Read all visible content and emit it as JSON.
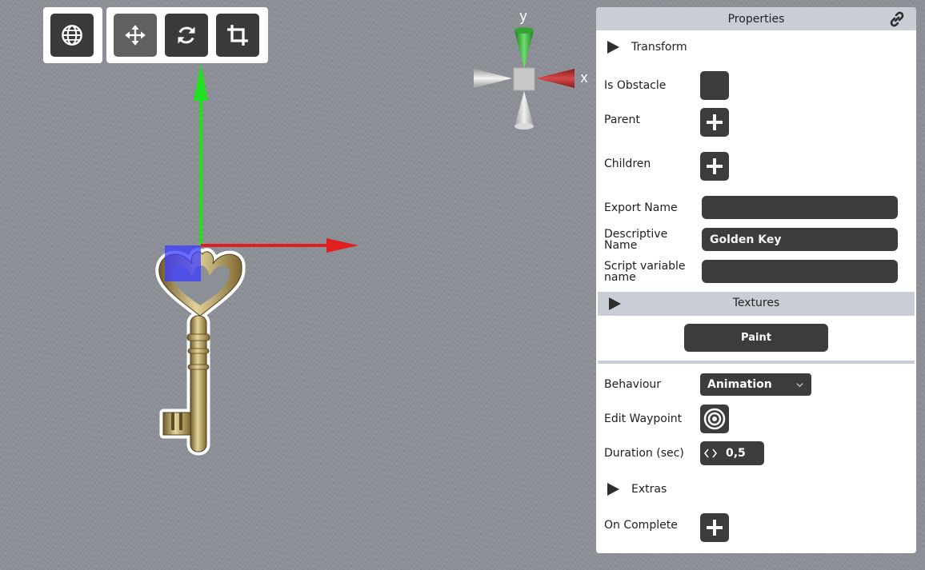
{
  "toolbar": {
    "world_tool": {
      "icon": "globe-icon"
    },
    "transform_tools": [
      {
        "name": "move-tool-button",
        "icon": "move-arrows-icon",
        "active": true
      },
      {
        "name": "rotate-tool-button",
        "icon": "rotate-icon",
        "active": false
      },
      {
        "name": "crop-tool-button",
        "icon": "crop-icon",
        "active": false
      }
    ]
  },
  "gizmo": {
    "y_label": "y",
    "x_label": "x",
    "colors": {
      "x": "#e02020",
      "y": "#22e022",
      "z": "#3b3bff"
    }
  },
  "panel": {
    "title": "Properties",
    "transform_label": "Transform",
    "is_obstacle_label": "Is Obstacle",
    "parent_label": "Parent",
    "children_label": "Children",
    "export_name_label": "Export Name",
    "export_name_value": "",
    "descriptive_name_label": "Descriptive\nName",
    "descriptive_name_value": "Golden Key",
    "script_var_label": "Script variable\nname",
    "script_var_value": "",
    "textures_label": "Textures",
    "paint_label": "Paint",
    "behaviour_label": "Behaviour",
    "behaviour_value": "Animation",
    "edit_waypoint_label": "Edit Waypoint",
    "duration_label": "Duration (sec)",
    "duration_value": "0,5",
    "extras_label": "Extras",
    "on_complete_label": "On Complete"
  }
}
